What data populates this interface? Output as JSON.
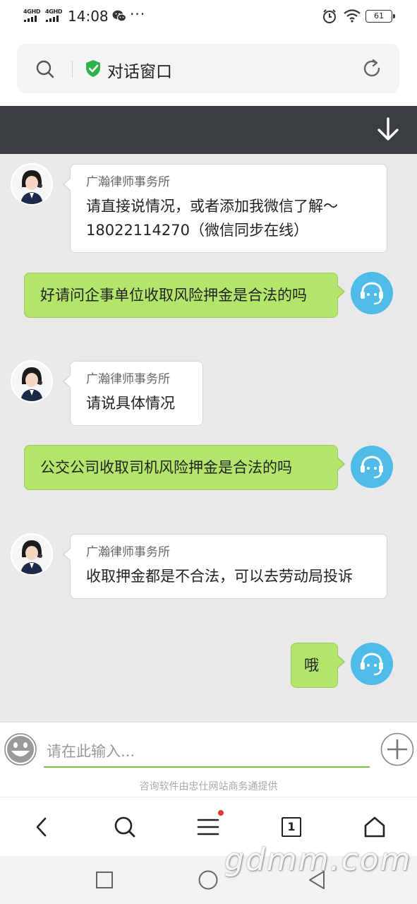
{
  "status_bar": {
    "network1": "4GHD",
    "network2": "4GHD",
    "time": "14:08",
    "more": "···",
    "battery": "61"
  },
  "header": {
    "title": "对话窗口"
  },
  "messages": [
    {
      "side": "left",
      "sender": "广瀚律师事务所",
      "text": "请直接说情况，或者添加我微信了解～18022114270（微信同步在线）"
    },
    {
      "side": "right",
      "text": "好请问企事单位收取风险押金是合法的吗"
    },
    {
      "side": "left",
      "sender": "广瀚律师事务所",
      "text": "请说具体情况"
    },
    {
      "side": "right",
      "text": "公交公司收取司机风险押金是合法的吗"
    },
    {
      "side": "left",
      "sender": "广瀚律师事务所",
      "text": "收取押金都是不合法，可以去劳动局投诉"
    },
    {
      "side": "right",
      "text": "哦"
    }
  ],
  "input": {
    "placeholder": "请在此输入..."
  },
  "credit": "咨询软件由忠仕网站商务通提供",
  "browser_nav": {
    "tab_count": "1"
  },
  "watermark": "gdmm.com",
  "colors": {
    "user_bubble": "#b3e56b",
    "agent_avatar": "#4fbbe8",
    "input_underline": "#7ac143",
    "header_dark": "#3a3d42"
  }
}
